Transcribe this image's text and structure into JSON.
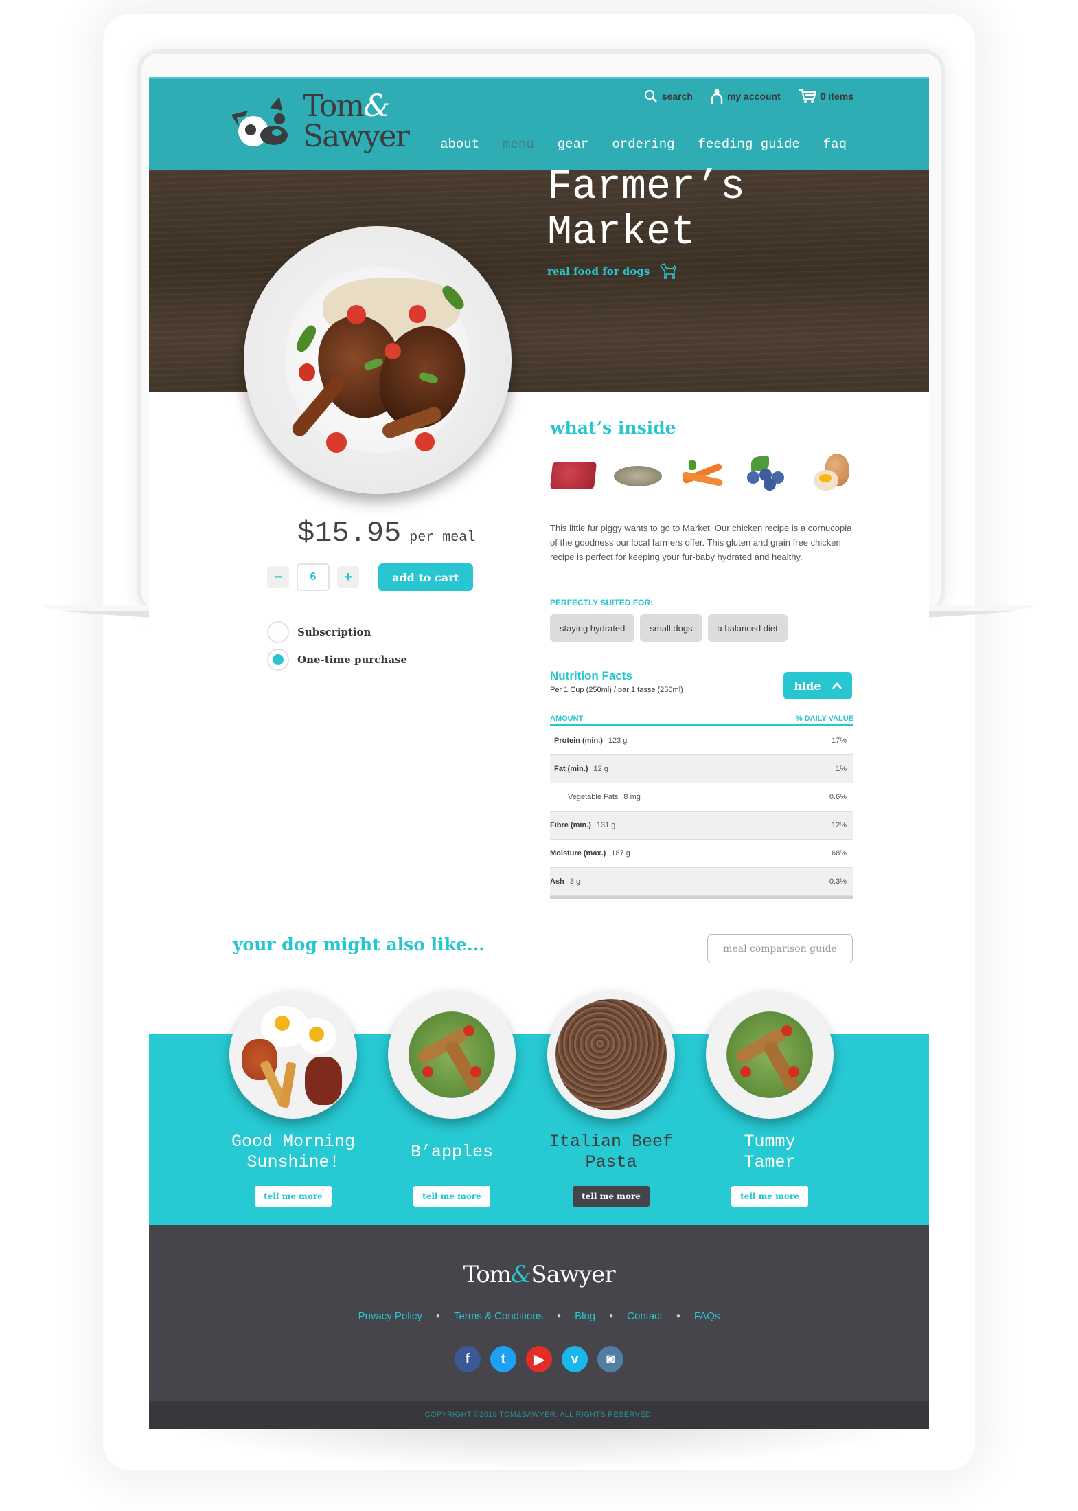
{
  "brand": {
    "name_line1": "Tom",
    "ampersand": "&",
    "name_line2": "Sawyer",
    "footer_name_left": "Tom",
    "footer_name_right": "Sawyer"
  },
  "utility_nav": [
    {
      "icon": "search-icon",
      "label": "search"
    },
    {
      "icon": "account-icon",
      "label": "my account"
    },
    {
      "icon": "cart-icon",
      "label": "0 items"
    }
  ],
  "main_nav": [
    {
      "label": "about",
      "active": false
    },
    {
      "label": "menu",
      "active": true
    },
    {
      "label": "gear",
      "active": false
    },
    {
      "label": "ordering",
      "active": false
    },
    {
      "label": "feeding guide",
      "active": false
    },
    {
      "label": "faq",
      "active": false
    }
  ],
  "product": {
    "title_line1": "Farmer’s",
    "title_line2": "Market",
    "tagline": "real food for dogs",
    "price": "$15.95",
    "price_unit": "per meal",
    "quantity": "6",
    "minus_label": "−",
    "plus_label": "+",
    "add_to_cart_label": "add to cart",
    "purchase_options": [
      {
        "label": "Subscription",
        "selected": false
      },
      {
        "label": "One-time purchase",
        "selected": true
      }
    ]
  },
  "whats_inside": {
    "title": "what’s inside",
    "ingredients": [
      "ground meat",
      "oats",
      "carrots",
      "blueberries",
      "egg"
    ],
    "description": "This little fur piggy wants to go to Market! Our chicken recipe is a cornucopia of the goodness our local farmers offer. This gluten and grain free chicken recipe is perfect for keeping your fur-baby hydrated and healthy.",
    "suited_label": "PERFECTLY SUITED FOR:",
    "suited_tags": [
      "staying hydrated",
      "small dogs",
      "a balanced diet"
    ]
  },
  "nutrition": {
    "title": "Nutrition Facts",
    "serving": "Per 1 Cup (250ml) / par 1 tasse (250ml)",
    "toggle_label": "hide",
    "col_amount": "AMOUNT",
    "col_daily": "% DAILY VALUE",
    "rows": [
      {
        "name": "Protein (min.)",
        "amount": "123 g",
        "daily": "17%",
        "sub": false
      },
      {
        "name": "Fat (min.)",
        "amount": "12 g",
        "daily": "1%",
        "sub": false
      },
      {
        "name": "Vegetable Fats",
        "amount": "8 mg",
        "daily": "0.6%",
        "sub": true
      },
      {
        "name": "Fibre (min.)",
        "amount": "131 g",
        "daily": "12%",
        "sub": false
      },
      {
        "name": "Moisture (max.)",
        "amount": "187 g",
        "daily": "68%",
        "sub": false
      },
      {
        "name": "Ash",
        "amount": "3 g",
        "daily": "0.3%",
        "sub": false
      }
    ]
  },
  "also_like": {
    "title": "your dog might also like...",
    "compare_label": "meal comparison guide",
    "items": [
      {
        "name_line1": "Good Morning",
        "name_line2": "Sunshine!",
        "button": "tell me more",
        "highlighted": false
      },
      {
        "name_line1": "B’apples",
        "name_line2": "",
        "button": "tell me more",
        "highlighted": false
      },
      {
        "name_line1": "Italian Beef",
        "name_line2": "Pasta",
        "button": "tell me more",
        "highlighted": true
      },
      {
        "name_line1": "Tummy",
        "name_line2": "Tamer",
        "button": "tell me more",
        "highlighted": false
      }
    ]
  },
  "footer": {
    "links": [
      "Privacy Policy",
      "Terms & Conditions",
      "Blog",
      "Contact",
      "FAQs"
    ],
    "socials": [
      {
        "name": "facebook",
        "glyph": "f",
        "color": "#3b5998"
      },
      {
        "name": "twitter",
        "glyph": "t",
        "color": "#1da1f2"
      },
      {
        "name": "youtube",
        "glyph": "▶",
        "color": "#e52d27"
      },
      {
        "name": "vimeo",
        "glyph": "v",
        "color": "#1ab7ea"
      },
      {
        "name": "instagram",
        "glyph": "◙",
        "color": "#517fa4"
      }
    ],
    "copyright": "COPYRIGHT ©2019 TOM&SAWYER. ALL RIGHTS RESERVED."
  },
  "colors": {
    "header_teal": "#2eaeb4",
    "accent": "#27c6d1",
    "dark": "#46454b"
  }
}
